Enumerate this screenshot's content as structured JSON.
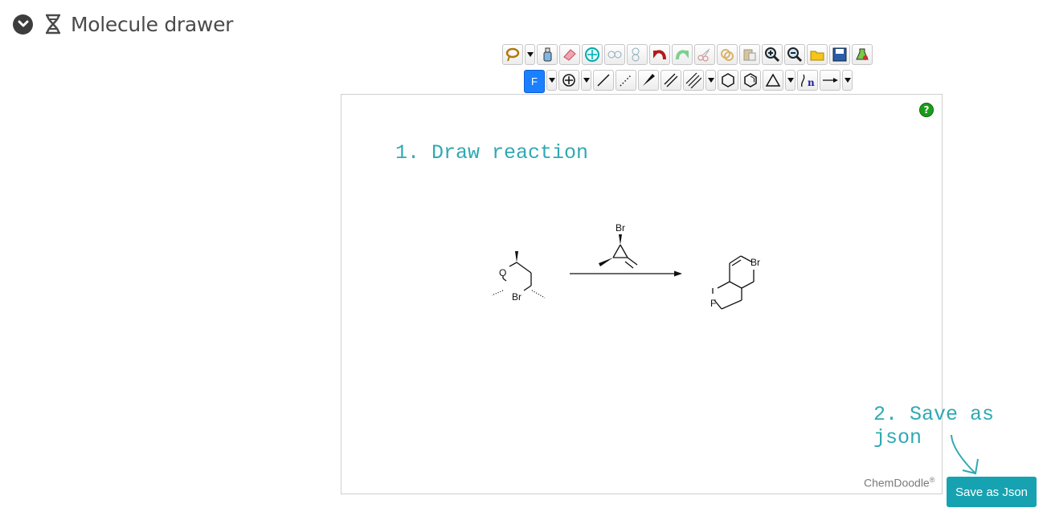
{
  "header": {
    "title": "Molecule drawer"
  },
  "toolbar": {
    "row1": [
      "lasso",
      "clear",
      "eraser",
      "center",
      "flip-horizontal",
      "flip-vertical",
      "undo",
      "redo",
      "cut",
      "copy",
      "paste",
      "zoom-in",
      "zoom-out",
      "open",
      "save",
      "settings"
    ],
    "row2": {
      "atom_label": "F"
    }
  },
  "canvas": {
    "help_label": "?",
    "instruction": "1. Draw reaction",
    "credit": "ChemDoodle",
    "credit_mark": "®"
  },
  "molecules": {
    "reactant_atoms": [
      "O",
      "Br"
    ],
    "reagent_atoms": [
      "Br"
    ],
    "product_atoms": [
      "Br",
      "F"
    ]
  },
  "instruction2": "2. Save as json",
  "save_button": "Save as Json"
}
